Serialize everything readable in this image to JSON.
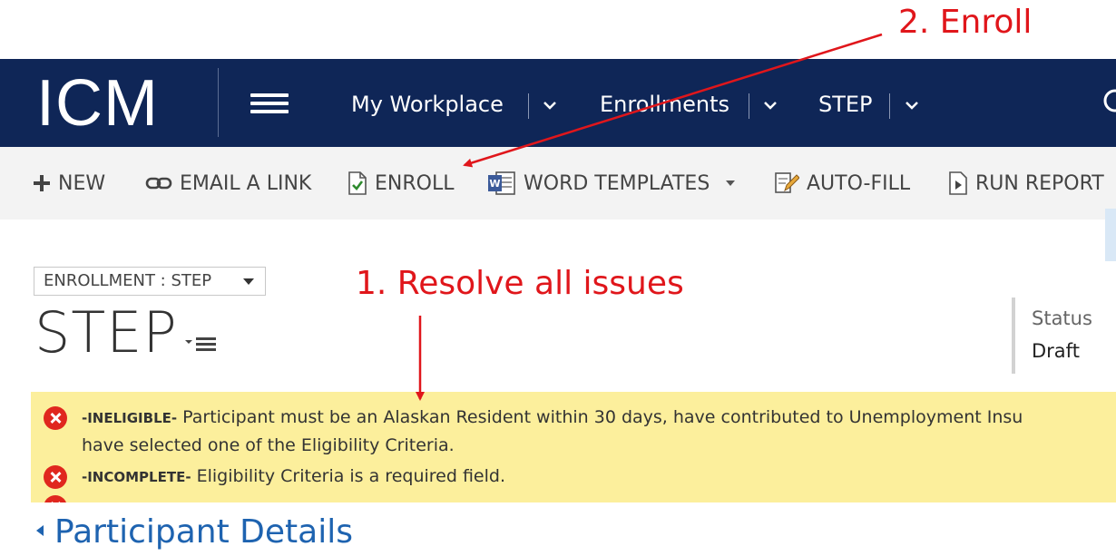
{
  "annotations": {
    "step2": "2. Enroll",
    "step1": "1. Resolve all issues"
  },
  "navbar": {
    "logo": "ICM",
    "items": [
      {
        "label": "My Workplace"
      },
      {
        "label": "Enrollments"
      },
      {
        "label": "STEP"
      }
    ]
  },
  "commands": {
    "new": "NEW",
    "email_link": "EMAIL A LINK",
    "enroll": "ENROLL",
    "word_templates": "WORD TEMPLATES",
    "auto_fill": "AUTO-FILL",
    "run_report": "RUN REPORT"
  },
  "form": {
    "selector": "ENROLLMENT : STEP",
    "title": "STEP",
    "status_label": "Status",
    "status_value": "Draft"
  },
  "notifications": [
    {
      "tag": "-INELIGIBLE-",
      "text": " Participant must be an Alaskan Resident within 30 days, have contributed to Unemployment Insu",
      "continuation": "have selected one of the Eligibility Criteria."
    },
    {
      "tag": "-INCOMPLETE-",
      "text": " Eligibility Criteria is a required field."
    }
  ],
  "section": {
    "title": "Participant Details"
  },
  "colors": {
    "navbar": "#0f2657",
    "annotation": "#e0161b",
    "notification_bg": "#fcef9c",
    "error_icon": "#e0271e",
    "section_title": "#1e63b0"
  }
}
